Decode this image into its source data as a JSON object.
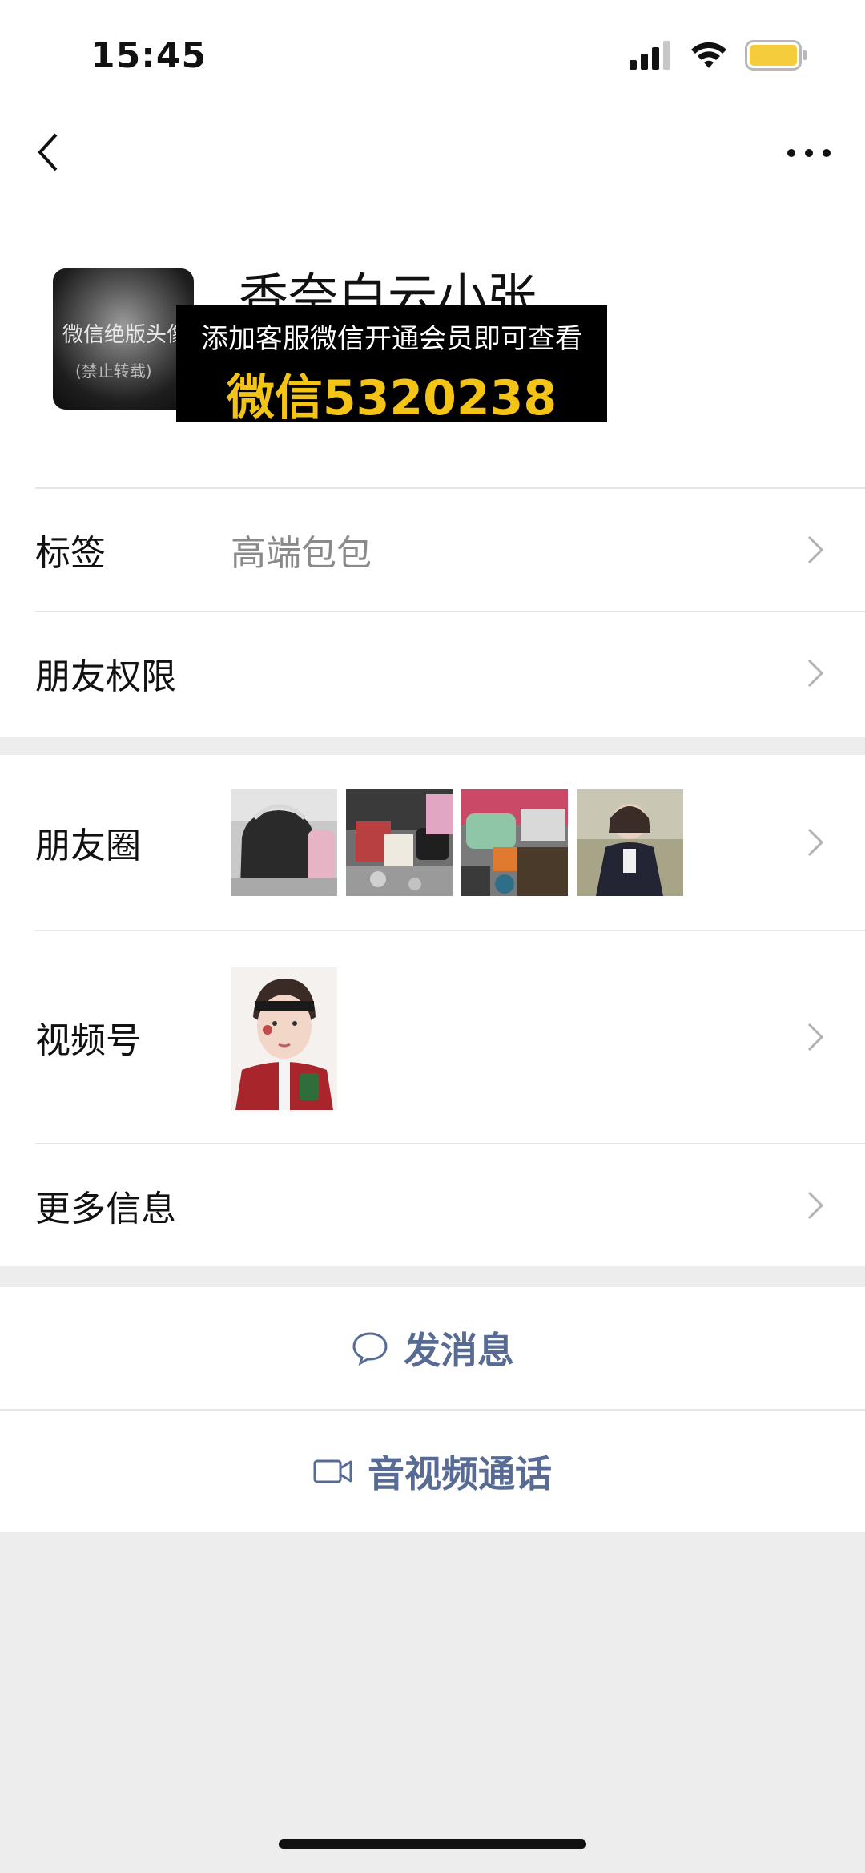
{
  "status_bar": {
    "time": "15:45"
  },
  "profile": {
    "name": "香奈白云小张",
    "avatar_text_line1": "微信绝版头像",
    "avatar_text_line2": "(禁止转载)"
  },
  "promo": {
    "line1": "添加客服微信开通会员即可查看",
    "line2": "微信5320238"
  },
  "rows": {
    "tags": {
      "label": "标签",
      "value": "高端包包"
    },
    "permissions": {
      "label": "朋友权限"
    },
    "moments": {
      "label": "朋友圈"
    },
    "channels": {
      "label": "视频号"
    },
    "more_info": {
      "label": "更多信息"
    }
  },
  "actions": {
    "message": "发消息",
    "call": "音视频通话"
  },
  "colors": {
    "link": "#576b95",
    "promo_yellow": "#f3c316",
    "battery": "#f5cc3c",
    "background": "#ededed"
  },
  "icons": [
    "back-icon",
    "more-icon",
    "chevron-right-icon",
    "chat-bubble-icon",
    "video-camera-icon",
    "signal-icon",
    "wifi-icon",
    "battery-icon"
  ]
}
